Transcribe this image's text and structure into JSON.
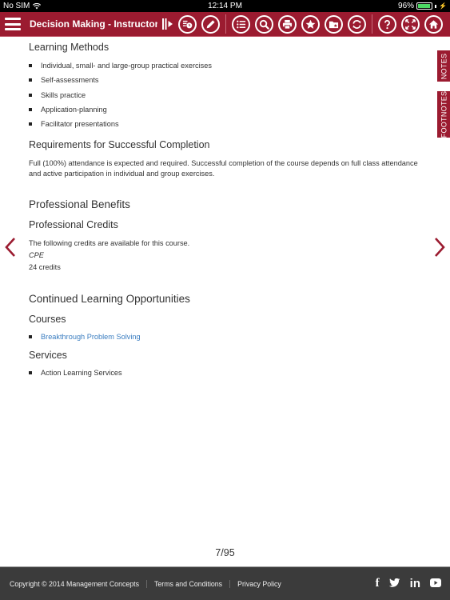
{
  "status_bar": {
    "carrier": "No SIM",
    "time": "12:14 PM",
    "battery_percent": "96%",
    "battery_level": 0.96
  },
  "toolbar": {
    "title": "Decision Making - Instructor's",
    "icons": [
      "menu-icon",
      "expand-panel-icon",
      "bookmark-history-icon",
      "pencil-icon",
      "list-icon",
      "search-icon",
      "print-icon",
      "star-icon",
      "folder-star-icon",
      "refresh-icon",
      "help-icon",
      "fullscreen-icon",
      "home-icon"
    ]
  },
  "side_tabs": {
    "notes": "NOTES",
    "footnotes": "FOOTNOTES"
  },
  "accent_color": "#9b1b30",
  "content": {
    "learning_methods": {
      "heading": "Learning Methods",
      "items": [
        "Individual, small- and large-group practical exercises",
        "Self-assessments",
        "Skills practice",
        "Application-planning",
        "Facilitator presentations"
      ]
    },
    "requirements": {
      "heading": "Requirements for Successful Completion",
      "text": "Full (100%) attendance is expected and required. Successful completion of the course depends on full class attendance and active participation in individual and group exercises."
    },
    "professional_benefits": {
      "heading": "Professional Benefits",
      "credits_heading": "Professional Credits",
      "intro": "The following credits are available for this course.",
      "credit_type": "CPE",
      "credit_amount": "24 credits"
    },
    "continued_learning": {
      "heading": "Continued Learning Opportunities",
      "courses_heading": "Courses",
      "courses": [
        "Breakthrough Problem Solving"
      ],
      "services_heading": "Services",
      "services": [
        "Action Learning Services"
      ]
    }
  },
  "page_indicator": "7/95",
  "footer": {
    "copyright": "Copyright © 2014 Management Concepts",
    "terms": "Terms and Conditions",
    "privacy": "Privacy Policy",
    "social": {
      "facebook": "f",
      "twitter": "🐦",
      "linkedin": "in",
      "youtube": "▶"
    }
  }
}
